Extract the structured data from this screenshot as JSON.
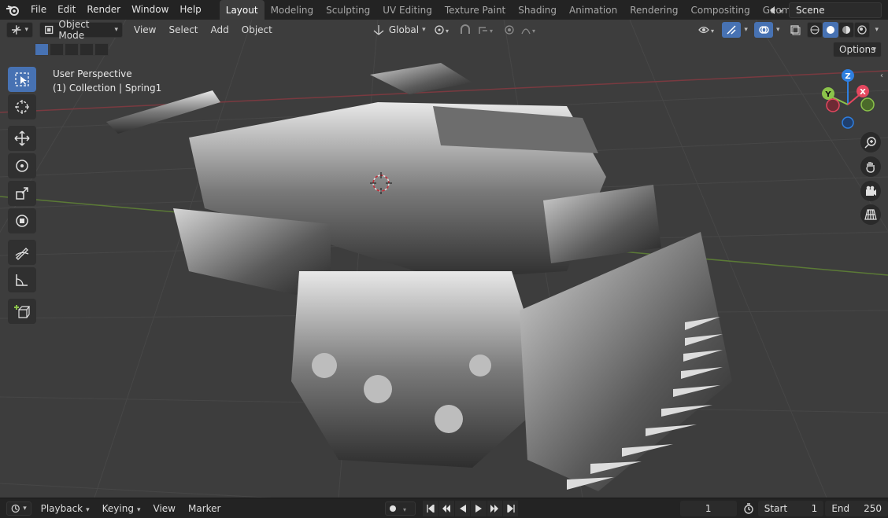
{
  "menu": {
    "file": "File",
    "edit": "Edit",
    "render": "Render",
    "window": "Window",
    "help": "Help"
  },
  "workspaces": [
    "Layout",
    "Modeling",
    "Sculpting",
    "UV Editing",
    "Texture Paint",
    "Shading",
    "Animation",
    "Rendering",
    "Compositing",
    "Geometry Nod"
  ],
  "active_workspace": "Layout",
  "scene": "Scene",
  "viewport_header": {
    "mode": "Object Mode",
    "view": "View",
    "select": "Select",
    "add": "Add",
    "object": "Object",
    "orientation": "Global",
    "options": "Options"
  },
  "overlay": {
    "perspective": "User Perspective",
    "collection": "(1) Collection | Spring1"
  },
  "gizmo": {
    "z": "Z",
    "y": "Y",
    "x": "X"
  },
  "toolbar_icons": [
    "select-box-icon",
    "cursor-icon",
    "move-icon",
    "rotate-icon",
    "scale-icon",
    "transform-icon",
    "annotate-icon",
    "measure-icon",
    "add-cube-icon"
  ],
  "timeline": {
    "playback": "Playback",
    "keying": "Keying",
    "view": "View",
    "marker": "Marker",
    "current_frame": "1",
    "start_label": "Start",
    "start_value": "1",
    "end_label": "End",
    "end_value": "250"
  },
  "colors": {
    "accent": "#4772b3",
    "x_axis": "#e5475f",
    "y_axis": "#8bc34a",
    "z_axis": "#2f7fe0",
    "viewport_bg": "#3d3d3d"
  }
}
